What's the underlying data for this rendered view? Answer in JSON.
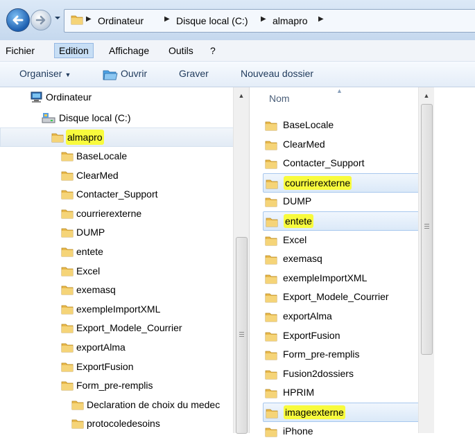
{
  "breadcrumb": [
    "Ordinateur",
    "Disque local (C:)",
    "almapro"
  ],
  "menu": [
    "Fichier",
    "Edition",
    "Affichage",
    "Outils",
    "?"
  ],
  "toolbar": {
    "organise": "Organiser",
    "open": "Ouvrir",
    "burn": "Graver",
    "new_folder": "Nouveau dossier"
  },
  "tree": {
    "computer": "Ordinateur",
    "local_disk": "Disque local (C:)",
    "selected": "almapro",
    "folders": [
      "BaseLocale",
      "ClearMed",
      "Contacter_Support",
      "courrierexterne",
      "DUMP",
      "entete",
      "Excel",
      "exemasq",
      "exempleImportXML",
      "Export_Modele_Courrier",
      "exportAlma",
      "ExportFusion",
      "Form_pre-remplis"
    ],
    "subfolders": [
      "Declaration de choix du medec",
      "protocoledesoins"
    ]
  },
  "content": {
    "column_name": "Nom",
    "files": [
      "BaseLocale",
      "ClearMed",
      "Contacter_Support",
      "courrierexterne",
      "DUMP",
      "entete",
      "Excel",
      "exemasq",
      "exempleImportXML",
      "Export_Modele_Courrier",
      "exportAlma",
      "ExportFusion",
      "Form_pre-remplis",
      "Fusion2dossiers",
      "HPRIM",
      "imageexterne",
      "iPhone"
    ],
    "highlighted": [
      "courrierexterne",
      "entete",
      "imageexterne"
    ]
  },
  "colors": {
    "highlight": "#f8fb3d",
    "selection": "#dbe9f8",
    "folder": "#e8b84a"
  }
}
